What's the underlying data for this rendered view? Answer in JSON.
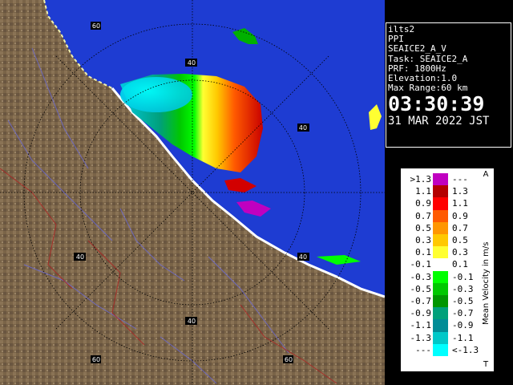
{
  "info": {
    "lines": [
      "ilts2",
      "PPI",
      "SEAICE2_A_V",
      "Task: SEAICE2_A",
      "PRF: 1800Hz",
      "Elevation:1.0",
      "Max Range:60 km"
    ],
    "time": "03:30:39",
    "date": "31 MAR 2022 JST"
  },
  "legend": {
    "title": "Mean Velocity in m/s",
    "corner_top": "A",
    "corner_bottom": "T",
    "rows": [
      {
        "left": ">1.3",
        "right": "---",
        "color": "#c000c0"
      },
      {
        "left": "1.1",
        "right": "1.3",
        "color": "#b40000"
      },
      {
        "left": "0.9",
        "right": "1.1",
        "color": "#ff0000"
      },
      {
        "left": "0.7",
        "right": "0.9",
        "color": "#ff5a00"
      },
      {
        "left": "0.5",
        "right": "0.7",
        "color": "#ff9600"
      },
      {
        "left": "0.3",
        "right": "0.5",
        "color": "#ffc800"
      },
      {
        "left": "0.1",
        "right": "0.3",
        "color": "#ffff32"
      },
      {
        "left": "-0.1",
        "right": "0.1",
        "color": "#ffffff"
      },
      {
        "left": "-0.3",
        "right": "-0.1",
        "color": "#00ff00"
      },
      {
        "left": "-0.5",
        "right": "-0.3",
        "color": "#00c800"
      },
      {
        "left": "-0.7",
        "right": "-0.5",
        "color": "#009600"
      },
      {
        "left": "-0.9",
        "right": "-0.7",
        "color": "#00a07a"
      },
      {
        "left": "-1.1",
        "right": "-0.9",
        "color": "#008c96"
      },
      {
        "left": "-1.3",
        "right": "-1.1",
        "color": "#00c8c8"
      },
      {
        "left": "---",
        "right": "<-1.3",
        "color": "#00ffff"
      }
    ]
  },
  "map": {
    "range_labels": [
      "60",
      "40",
      "40",
      "40",
      "40",
      "60",
      "40",
      "60"
    ],
    "sea_color": "#1e3cd2",
    "land_color": "#7a6448"
  }
}
